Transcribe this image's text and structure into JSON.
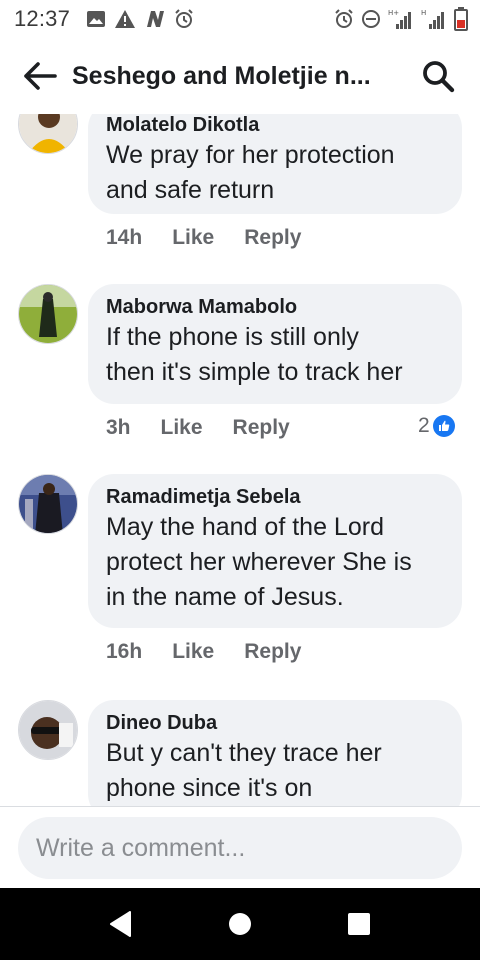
{
  "status_bar": {
    "time": "12:37",
    "left_icons": [
      "image-icon",
      "warning-icon",
      "n-icon",
      "alarm-icon"
    ],
    "right_icons": [
      "alarm-icon",
      "do-not-disturb-icon",
      "signal-h-plus-icon",
      "signal-h-icon",
      "battery-icon"
    ],
    "network_label_1": "H+",
    "network_label_2": "H"
  },
  "header": {
    "title": "Seshego and Moletjie n...",
    "back_icon": "back-arrow-icon",
    "search_icon": "search-icon"
  },
  "comments": [
    {
      "author": "Molatelo Dikotla",
      "lines": [
        "We pray for her protection",
        "and safe return"
      ],
      "time": "14h",
      "like_label": "Like",
      "reply_label": "Reply"
    },
    {
      "author": "Maborwa Mamabolo",
      "lines": [
        "If the phone is still only",
        "then it's simple to track her"
      ],
      "time": "3h",
      "like_label": "Like",
      "reply_label": "Reply",
      "reaction_count": "2"
    },
    {
      "author": "Ramadimetja Sebela",
      "lines": [
        "May the hand of the Lord",
        "protect her wherever She is",
        "in the name of Jesus."
      ],
      "time": "16h",
      "like_label": "Like",
      "reply_label": "Reply"
    },
    {
      "author": "Dineo Duba",
      "lines": [
        "But y can't they trace her",
        "phone since it's on"
      ]
    }
  ],
  "composer": {
    "placeholder": "Write a comment..."
  },
  "nav_bar": {
    "buttons": [
      "back-triangle-icon",
      "home-circle-icon",
      "recents-square-icon"
    ]
  },
  "colors": {
    "bubble": "#f0f2f5",
    "like_blue": "#1877f2",
    "secondary_text": "#65676b",
    "nav_bar": "#000000"
  }
}
